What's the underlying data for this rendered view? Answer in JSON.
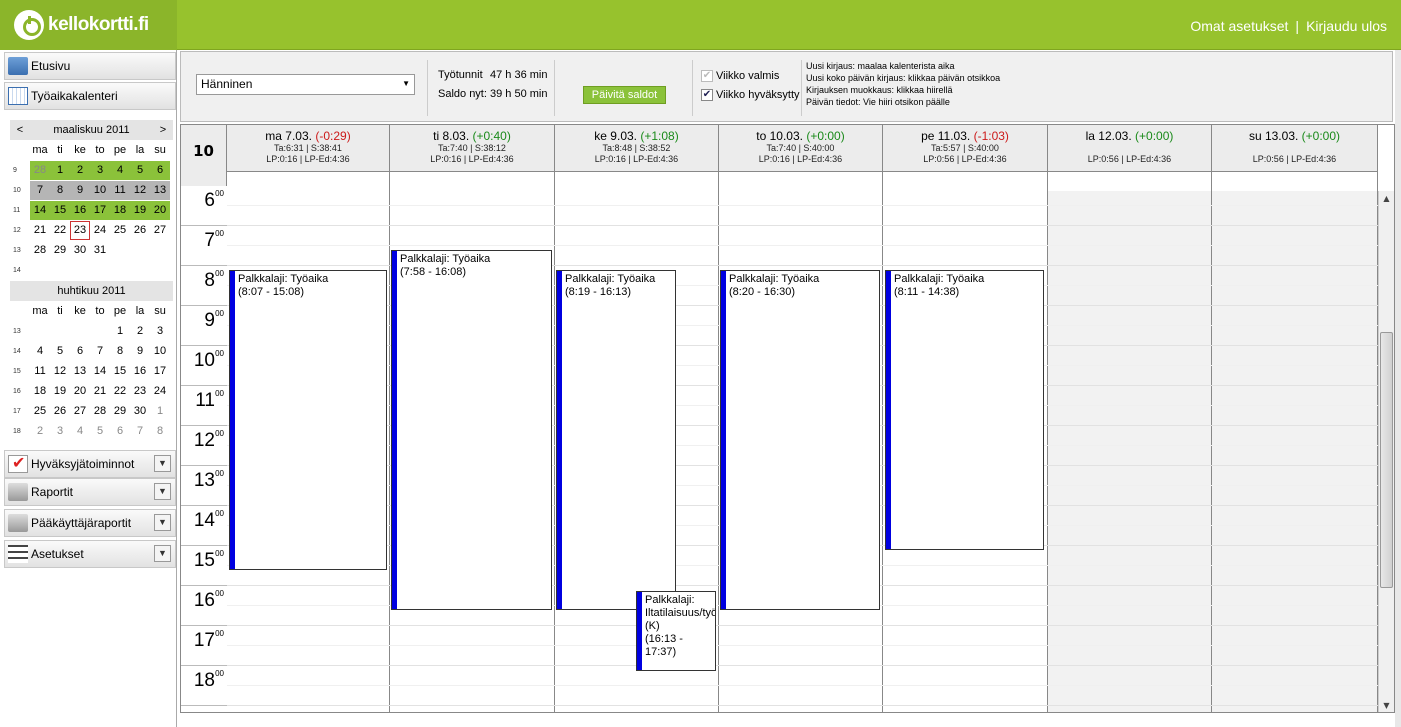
{
  "header": {
    "logo_text": "kellokortti.fi",
    "settings_link": "Omat asetukset",
    "separator": "|",
    "logout_link": "Kirjaudu ulos"
  },
  "sidebar": {
    "home": "Etusivu",
    "calendar": "Työaikakalenteri",
    "approvals": "Hyväksyjätoiminnot",
    "reports": "Raportit",
    "admin_reports": "Pääkäyttäjäraportit",
    "settings": "Asetukset"
  },
  "minical_march": {
    "prev": "<",
    "next": ">",
    "title": "maaliskuu 2011",
    "dow": [
      "ma",
      "ti",
      "ke",
      "to",
      "pe",
      "la",
      "su"
    ],
    "weeks": [
      {
        "wk": "9",
        "days": [
          "28",
          "1",
          "2",
          "3",
          "4",
          "5",
          "6"
        ]
      },
      {
        "wk": "10",
        "days": [
          "7",
          "8",
          "9",
          "10",
          "11",
          "12",
          "13"
        ]
      },
      {
        "wk": "11",
        "days": [
          "14",
          "15",
          "16",
          "17",
          "18",
          "19",
          "20"
        ]
      },
      {
        "wk": "12",
        "days": [
          "21",
          "22",
          "23",
          "24",
          "25",
          "26",
          "27"
        ]
      },
      {
        "wk": "13",
        "days": [
          "28",
          "29",
          "30",
          "31",
          "",
          "",
          ""
        ]
      },
      {
        "wk": "14",
        "days": [
          "",
          "",
          "",
          "",
          "",
          "",
          ""
        ]
      }
    ]
  },
  "minical_april": {
    "title": "huhtikuu 2011",
    "dow": [
      "ma",
      "ti",
      "ke",
      "to",
      "pe",
      "la",
      "su"
    ],
    "weeks": [
      {
        "wk": "13",
        "days": [
          "",
          "",
          "",
          "",
          "1",
          "2",
          "3"
        ]
      },
      {
        "wk": "14",
        "days": [
          "4",
          "5",
          "6",
          "7",
          "8",
          "9",
          "10"
        ]
      },
      {
        "wk": "15",
        "days": [
          "11",
          "12",
          "13",
          "14",
          "15",
          "16",
          "17"
        ]
      },
      {
        "wk": "16",
        "days": [
          "18",
          "19",
          "20",
          "21",
          "22",
          "23",
          "24"
        ]
      },
      {
        "wk": "17",
        "days": [
          "25",
          "26",
          "27",
          "28",
          "29",
          "30",
          "1"
        ]
      },
      {
        "wk": "18",
        "days": [
          "2",
          "3",
          "4",
          "5",
          "6",
          "7",
          "8"
        ]
      }
    ]
  },
  "toolbar": {
    "employee": "Hänninen",
    "work_hours_label": "Työtunnit",
    "work_hours_value": "47 h 36 min",
    "balance_label": "Saldo nyt:",
    "balance_value": "39 h 50 min",
    "update_button": "Päivitä saldot",
    "week_done": "Viikko valmis",
    "week_approved": "Viikko hyväksytty",
    "help": [
      "Uusi kirjaus: maalaa kalenterista aika",
      "Uusi koko päivän kirjaus: klikkaa päivän otsikkoa",
      "Kirjauksen muokkaus: klikkaa hiirellä",
      "Päivän tiedot: Vie hiiri otsikon päälle"
    ]
  },
  "calendar": {
    "week_number": "10",
    "days": [
      {
        "title": "ma 7.03.",
        "balance": "(-0:29)",
        "sign": "neg",
        "line1": "Ta:6:31 | S:38:41",
        "line2": "LP:0:16 | LP-Ed:4:36"
      },
      {
        "title": "ti 8.03.",
        "balance": "(+0:40)",
        "sign": "pos",
        "line1": "Ta:7:40 | S:38:12",
        "line2": "LP:0:16 | LP-Ed:4:36"
      },
      {
        "title": "ke 9.03.",
        "balance": "(+1:08)",
        "sign": "pos",
        "line1": "Ta:8:48 | S:38:52",
        "line2": "LP:0:16 | LP-Ed:4:36"
      },
      {
        "title": "to 10.03.",
        "balance": "(+0:00)",
        "sign": "pos",
        "line1": "Ta:7:40 | S:40:00",
        "line2": "LP:0:16 | LP-Ed:4:36"
      },
      {
        "title": "pe 11.03.",
        "balance": "(-1:03)",
        "sign": "neg",
        "line1": "Ta:5:57 | S:40:00",
        "line2": "LP:0:56 | LP-Ed:4:36"
      },
      {
        "title": "la 12.03.",
        "balance": "(+0:00)",
        "sign": "pos",
        "line1": "",
        "line2": "LP:0:56 | LP-Ed:4:36"
      },
      {
        "title": "su 13.03.",
        "balance": "(+0:00)",
        "sign": "pos",
        "line1": "",
        "line2": "LP:0:56 | LP-Ed:4:36"
      }
    ],
    "hours": [
      "6",
      "7",
      "8",
      "9",
      "10",
      "11",
      "12",
      "13",
      "14",
      "15",
      "16",
      "17",
      "18"
    ],
    "minutes_label": "00",
    "events": [
      {
        "label": "Palkkalaji: Työaika",
        "time": "(8:07 - 15:08)"
      },
      {
        "label": "Palkkalaji: Työaika",
        "time": "(7:58 - 16:08)"
      },
      {
        "label": "Palkkalaji: Työaika",
        "time": "(8:19 - 16:13)"
      },
      {
        "label": "Palkkalaji: Iltatilaisuus/työ (K)",
        "time": "(16:13 - 17:37)"
      },
      {
        "label": "Palkkalaji: Työaika",
        "time": "(8:20 - 16:30)"
      },
      {
        "label": "Palkkalaji: Työaika",
        "time": "(8:11 - 14:38)"
      }
    ]
  }
}
